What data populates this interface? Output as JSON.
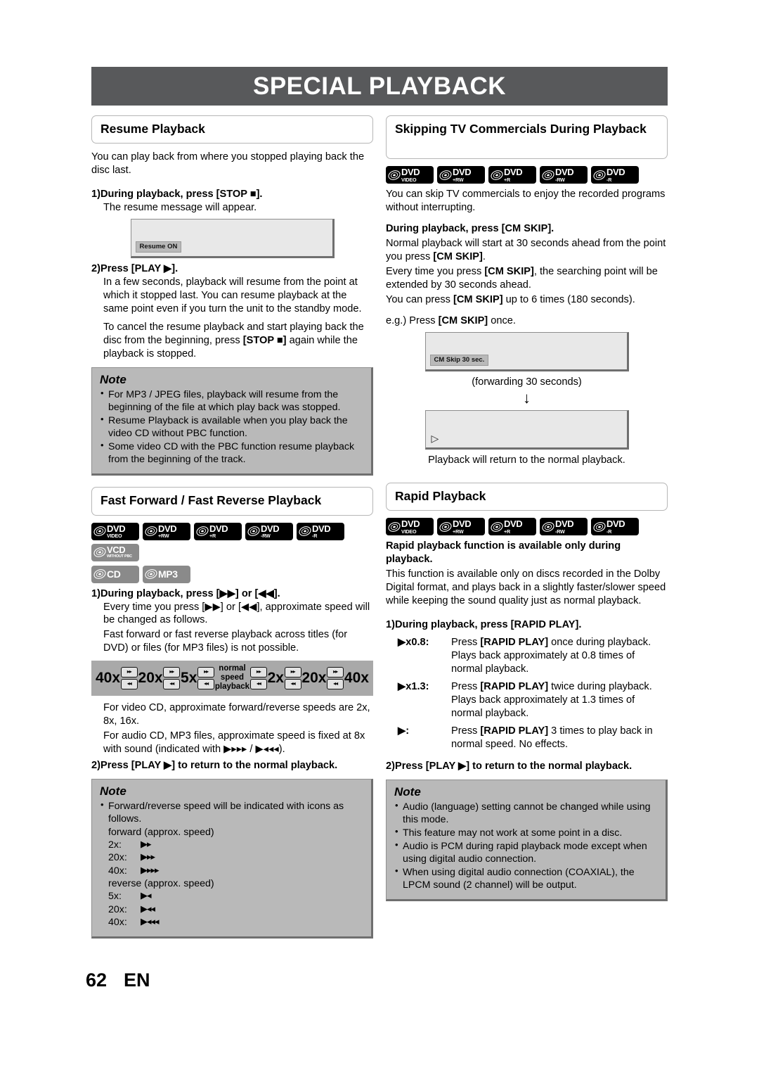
{
  "banner": {
    "title": "SPECIAL PLAYBACK"
  },
  "footer": {
    "page_number": "62",
    "language": "EN"
  },
  "icon_labels": {
    "dvd_video": {
      "l1": "DVD",
      "l2": "VIDEO"
    },
    "dvd_plus_rw": {
      "l1": "DVD",
      "l2": "+RW"
    },
    "dvd_plus_r": {
      "l1": "DVD",
      "l2": "+R"
    },
    "dvd_minus_rw": {
      "l1": "DVD",
      "l2": "-RW"
    },
    "dvd_minus_r": {
      "l1": "DVD",
      "l2": "-R"
    },
    "vcd": {
      "l1": "VCD",
      "l2": "WITHOUT PBC"
    },
    "cd": {
      "l1": "CD",
      "l2": ""
    },
    "mp3": {
      "l1": "MP3",
      "l2": ""
    }
  },
  "resume_playback": {
    "heading": "Resume Playback",
    "intro": "You can play back from where you stopped playing back the disc last.",
    "step1_num": "1)",
    "step1_label": "During playback, press [STOP ■].",
    "step1_text": "The resume message will appear.",
    "screen_osd": "Resume ON",
    "step2_num": "2)",
    "step2_label": "Press [PLAY ▶].",
    "step2_para1": "In a few seconds, playback will resume from the point at which it stopped last. You can resume playback at the same point even if you turn the unit to the standby mode.",
    "step2_para2_a": "To cancel the resume playback and start playing back the disc from the beginning, press ",
    "step2_para2_b": "[STOP ■]",
    "step2_para2_c": " again while the playback is stopped.",
    "note_title": "Note",
    "notes": [
      "For MP3 / JPEG files, playback will resume from the beginning of the file at which play back was stopped.",
      "Resume Playback is available when you play back the video CD without PBC function.",
      "Some video CD with the PBC function resume playback from the beginning of the track."
    ]
  },
  "fast_forward": {
    "heading": "Fast Forward / Fast Reverse Playback",
    "step1_num": "1)",
    "step1_label": "During playback, press [▶▶] or [◀◀].",
    "step1_para1": "Every time you press [▶▶] or [◀◀], approximate speed will be changed as follows.",
    "step1_para2": "Fast forward or fast reverse playback across titles (for DVD) or files (for MP3 files) is not possible.",
    "speed_diagram": {
      "labels": [
        "40x",
        "20x",
        "5x",
        "normal speed playback",
        "2x",
        "20x",
        "40x"
      ],
      "normal_line1": "normal",
      "normal_line2": "speed",
      "normal_line3": "playback",
      "btn_forward": "▸▸",
      "btn_reverse": "◂◂"
    },
    "para_video_cd": "For video CD, approximate forward/reverse speeds are 2x, 8x, 16x.",
    "para_audio_cd": "For audio CD, MP3 files, approximate speed is fixed at 8x with sound (indicated with ▶▸▸▸ / ▶◂◂◂).",
    "step2_num": "2)",
    "step2_label": "Press [PLAY ▶] to return to the normal playback.",
    "note_title": "Note",
    "note_bullet": "Forward/reverse speed will be indicated with icons as follows.",
    "forward_heading": "forward (approx. speed)",
    "forward_rows": [
      {
        "key": "2x:",
        "icon": "▶▸"
      },
      {
        "key": "20x:",
        "icon": "▶▸▸"
      },
      {
        "key": "40x:",
        "icon": "▶▸▸▸"
      }
    ],
    "reverse_heading": "reverse (approx. speed)",
    "reverse_rows": [
      {
        "key": "5x:",
        "icon": "▶◂"
      },
      {
        "key": "20x:",
        "icon": "▶◂◂"
      },
      {
        "key": "40x:",
        "icon": "▶◂◂◂"
      }
    ]
  },
  "cm_skip": {
    "heading": "Skipping TV Commercials During Playback",
    "intro": "You can skip TV commercials to enjoy the recorded programs without interrupting.",
    "bold_line": "During playback, press [CM SKIP].",
    "para1_a": "Normal playback will start at 30 seconds ahead from the point you press ",
    "para1_b": "[CM SKIP]",
    "para1_c": ".",
    "para2_a": "Every time you press ",
    "para2_b": "[CM SKIP]",
    "para2_c": ", the searching point will be extended by 30 seconds ahead.",
    "para3_a": "You can press ",
    "para3_b": "[CM SKIP]",
    "para3_c": " up to 6 times (180 seconds).",
    "eg_a": "e.g.) Press ",
    "eg_b": "[CM SKIP]",
    "eg_c": " once.",
    "screen1_osd": "CM Skip 30 sec.",
    "forwarding_caption": "(forwarding 30 seconds)",
    "arrow": "↓",
    "screen2_glyph": "▷",
    "closing": "Playback will return to the normal playback."
  },
  "rapid_playback": {
    "heading": "Rapid Playback",
    "bold_line": "Rapid playback function is available only during playback.",
    "intro": "This function is available only on discs recorded in the Dolby Digital format, and plays back in a slightly faster/slower speed while keeping the sound quality just as normal playback.",
    "step1_num": "1)",
    "step1_label": "During playback, press [RAPID PLAY].",
    "defs": [
      {
        "term": "▶x0.8:",
        "a": "Press ",
        "b": "[RAPID PLAY]",
        "c": " once during playback. Plays back approximately at 0.8 times of normal playback."
      },
      {
        "term": "▶x1.3:",
        "a": "Press ",
        "b": "[RAPID PLAY]",
        "c": " twice during playback. Plays back approximately at 1.3 times of normal playback."
      },
      {
        "term": "▶:",
        "a": "Press ",
        "b": "[RAPID PLAY]",
        "c": " 3 times to play back in normal speed. No effects."
      }
    ],
    "step2_num": "2)",
    "step2_label": "Press [PLAY ▶] to return to the normal playback.",
    "note_title": "Note",
    "notes": [
      "Audio (language) setting cannot be changed while using this mode.",
      "This feature may not work at some point in a disc.",
      "Audio is PCM during rapid playback mode except when using digital audio connection.",
      "When using digital audio connection (COAXIAL), the LPCM sound (2 channel) will be output."
    ]
  }
}
